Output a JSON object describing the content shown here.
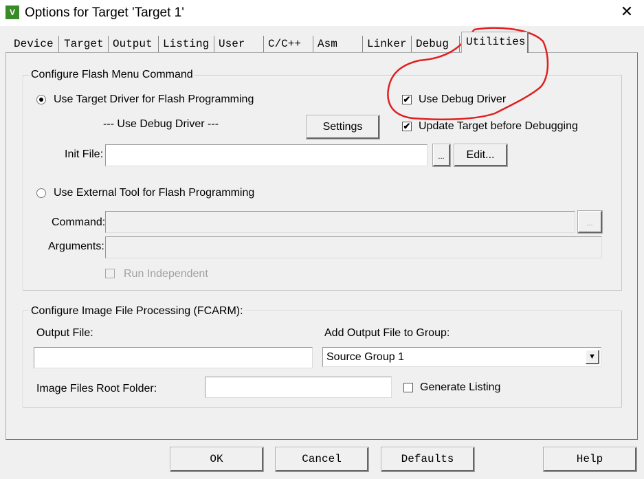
{
  "window": {
    "title": "Options for Target 'Target 1'",
    "close_icon": "close-icon",
    "app_icon": "keil-uv5-icon"
  },
  "tabs": [
    {
      "label": "Device"
    },
    {
      "label": "Target"
    },
    {
      "label": "Output"
    },
    {
      "label": "Listing"
    },
    {
      "label": "User"
    },
    {
      "label": "C/C++"
    },
    {
      "label": "Asm"
    },
    {
      "label": "Linker"
    },
    {
      "label": "Debug"
    },
    {
      "label": "Utilities",
      "selected": true
    }
  ],
  "flash": {
    "legend": "Configure Flash Menu Command",
    "use_target_driver": {
      "label": "Use Target Driver for Flash Programming",
      "selected": true
    },
    "driver_name": "--- Use Debug Driver ---",
    "settings": "Settings",
    "use_debug_driver": {
      "label": "Use Debug Driver",
      "checked": true
    },
    "update_target": {
      "label": "Update Target before Debugging",
      "checked": true
    },
    "init_file_label": "Init File:",
    "init_file_value": "",
    "browse": "...",
    "edit": "Edit...",
    "use_external": {
      "label": "Use External Tool for Flash Programming",
      "selected": false
    },
    "command_label": "Command:",
    "command_value": "",
    "command_browse": "...",
    "arguments_label": "Arguments:",
    "arguments_value": "",
    "run_independent": {
      "label": "Run Independent",
      "checked": false,
      "disabled": true
    }
  },
  "image": {
    "legend": "Configure Image File Processing (FCARM):",
    "output_file_label": "Output File:",
    "output_file_value": "",
    "add_to_group_label": "Add Output File  to Group:",
    "group_value": "Source Group 1",
    "root_folder_label": "Image Files Root Folder:",
    "root_folder_value": "",
    "generate_listing": {
      "label": "Generate Listing",
      "checked": false
    }
  },
  "buttons": {
    "ok": "OK",
    "cancel": "Cancel",
    "defaults": "Defaults",
    "help": "Help"
  },
  "annotation_color": "#e02020"
}
